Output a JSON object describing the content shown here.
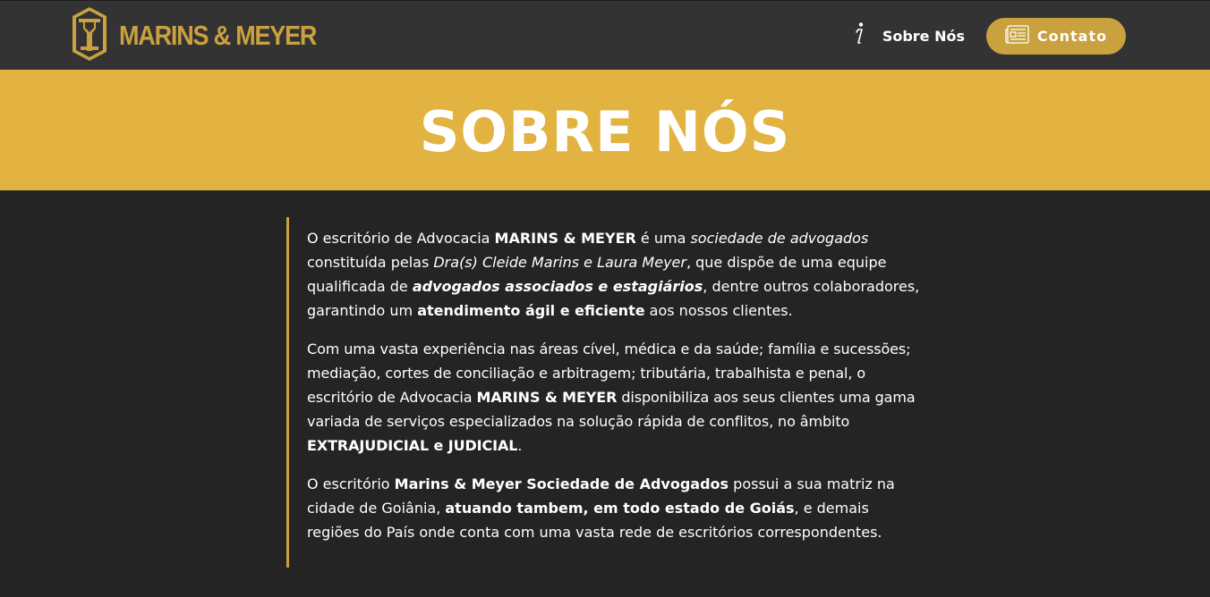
{
  "colors": {
    "navbar_bg": "#333333",
    "page_bg": "#242424",
    "gold": "#c9a13f",
    "hero_bg": "#e2b340",
    "text": "#ffffff"
  },
  "header": {
    "brand": {
      "name": "MARINS & MEYER",
      "logo_icon": "my-monogram-logo"
    },
    "nav": {
      "sobre": {
        "label": "Sobre Nós",
        "icon": "info-icon"
      },
      "contato": {
        "label": "Contato",
        "icon": "newspaper-icon"
      }
    }
  },
  "hero": {
    "title": "SOBRE NÓS"
  },
  "about": {
    "p1": {
      "s1": "O escritório de Advocacia ",
      "s2": "MARINS & MEYER",
      "s3": " é uma ",
      "s4": "sociedade de advogados",
      "s5": " constituída pelas ",
      "s6": "Dra(s) Cleide Marins e Laura Meyer",
      "s7": ", que dispõe de uma equipe qualificada de ",
      "s8": "advogados associados e estagiários",
      "s9": ", dentre outros colaboradores, garantindo um ",
      "s10": "atendimento ágil e eficiente",
      "s11": " aos nossos clientes."
    },
    "p2": {
      "s1": "Com uma vasta experiência nas áreas cível, médica e da saúde; família e sucessões; mediação, cortes de conciliação e arbitragem; tributária, trabalhista e penal, o escritório de Advocacia ",
      "s2": "MARINS & MEYER",
      "s3": " disponibiliza aos seus clientes uma gama variada de serviços especializados na solução rápida de conflitos, no âmbito ",
      "s4": "EXTRAJUDICIAL e JUDICIAL",
      "s5": "."
    },
    "p3": {
      "s1": "O escritório ",
      "s2": "Marins & Meyer Sociedade de Advogados",
      "s3": " possui a sua matriz na cidade de Goiânia, ",
      "s4": "atuando tambem, em todo estado de Goiás",
      "s5": ", e demais regiões do País onde conta com uma vasta rede de escritórios correspondentes."
    }
  }
}
